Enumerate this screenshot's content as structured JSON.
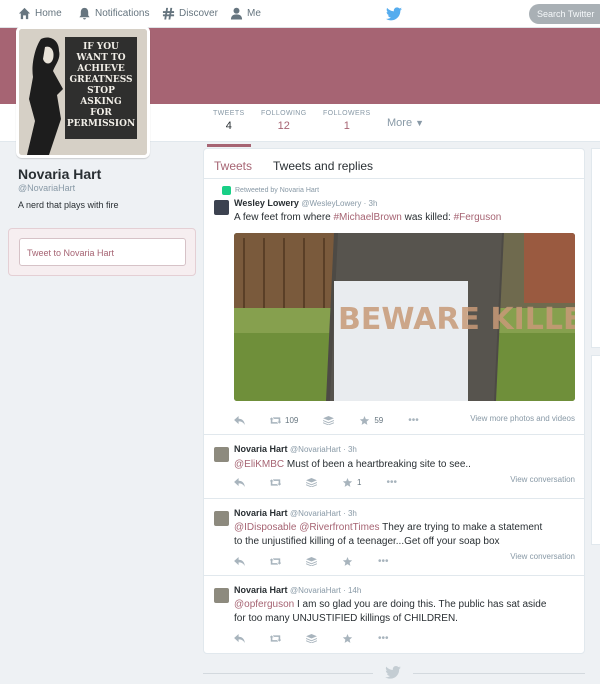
{
  "nav": {
    "home": "Home",
    "notifications": "Notifications",
    "discover": "Discover",
    "me": "Me",
    "search_placeholder": "Search Twitter"
  },
  "profile": {
    "name": "Novaria Hart",
    "handle": "@NovariaHart",
    "bio": "A nerd that plays with fire",
    "tweet_to_placeholder": "Tweet to Novaria Hart",
    "avatar_text": [
      "IF YOU",
      "WANT TO",
      "ACHIEVE",
      "GREATNESS",
      "STOP",
      "ASKING",
      "FOR",
      "PERMISSION"
    ]
  },
  "stats": [
    {
      "label": "TWEETS",
      "value": "4"
    },
    {
      "label": "FOLLOWING",
      "value": "12"
    },
    {
      "label": "FOLLOWERS",
      "value": "1"
    }
  ],
  "more_label": "More",
  "tabs": [
    "Tweets",
    "Tweets and replies"
  ],
  "colors": {
    "accent": "#a66473",
    "twitter_blue": "#55acee",
    "retweet_green": "#19cf86"
  },
  "tweets": [
    {
      "retweeted_by": "Retweeted by Novaria Hart",
      "name": "Wesley Lowery",
      "meta": "@WesleyLowery · 3h",
      "text_parts": [
        "A few feet from where ",
        "#MichaelBrown",
        " was killed: ",
        "#Ferguson"
      ],
      "image_text": "BEWARE KILLER COP",
      "retweets": "109",
      "favorites": "59",
      "link": "View more photos and videos"
    },
    {
      "name": "Novaria Hart",
      "meta": "@NovariaHart · 3h",
      "mention": "@EliKMBC",
      "text": " Must of been a heartbreaking site to see..",
      "retweets": "",
      "favorites": "1",
      "link": "View conversation"
    },
    {
      "name": "Novaria Hart",
      "meta": "@NovariaHart · 3h",
      "mention": "@IDisposable",
      "mention2": "@RiverfrontTimes",
      "text1": "  They are trying to make a statement",
      "text2": "to the unjustified killing of a teenager...Get off your soap box",
      "link": "View conversation"
    },
    {
      "name": "Novaria Hart",
      "meta": "@NovariaHart · 14h",
      "mention": "@opferguson",
      "text1": " I am so glad you are doing this. The public has sat aside",
      "text2": "for too many UNJUSTIFIED killings of CHILDREN."
    }
  ]
}
